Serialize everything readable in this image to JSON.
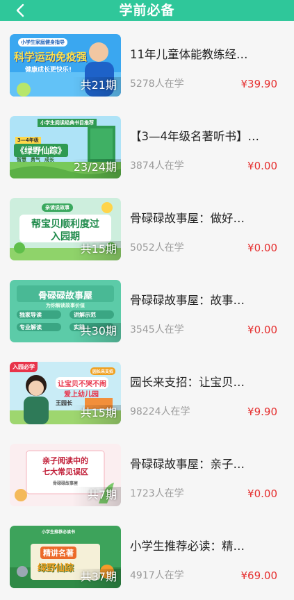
{
  "header": {
    "title": "学前必备",
    "back_icon": "chevron-left-icon"
  },
  "theme": {
    "accent": "#2fc79a",
    "price_color": "#e52f2f",
    "muted": "#9a9a9a"
  },
  "courses": [
    {
      "title": "11年儿童体能教练经…",
      "learners": "5278人在学",
      "price": "¥39.90",
      "periods": "共21期",
      "poster": {
        "banner": "小学生家庭健身指导",
        "headline": "科学运动免疫强",
        "sub": "健康成长更快乐!"
      }
    },
    {
      "title": "【3—4年级名著听书】…",
      "learners": "3874人在学",
      "price": "¥0.00",
      "periods": "23/24期",
      "poster": {
        "banner": "小学生阅读经典书目推荐",
        "grade": "3—4年级",
        "headline": "《绿野仙踪》",
        "tags": [
          "智慧",
          "勇气",
          "成长"
        ]
      }
    },
    {
      "title": "骨碌碌故事屋：做好…",
      "learners": "5052人在学",
      "price": "¥0.00",
      "periods": "共15期",
      "poster": {
        "banner": "亲读说故事",
        "headline": "帮宝贝顺利度过",
        "headline2": "入园期"
      }
    },
    {
      "title": "骨碌碌故事屋：故事…",
      "learners": "3545人在学",
      "price": "¥0.00",
      "periods": "共30期",
      "poster": {
        "headline": "骨碌碌故事屋",
        "sub": "为你解读故事价值",
        "tags": [
          "独家导读",
          "讲解示范",
          "专业解读",
          "实践"
        ]
      }
    },
    {
      "title": "园长来支招：让宝贝…",
      "learners": "98224人在学",
      "price": "¥9.90",
      "periods": "共15期",
      "poster": {
        "badge": "入园必学",
        "corner": "园长来支招",
        "headline": "让宝贝不哭不闹",
        "headline2": "爱上幼儿园",
        "person": "王园长"
      }
    },
    {
      "title": "骨碌碌故事屋：亲子…",
      "learners": "1723人在学",
      "price": "¥0.00",
      "periods": "共7期",
      "poster": {
        "headline": "亲子阅读中的",
        "headline2": "七大常见误区",
        "sub": "骨碌碌故事屋"
      }
    },
    {
      "title": "小学生推荐必读：精…",
      "learners": "4917人在学",
      "price": "¥69.00",
      "periods": "共37期",
      "poster": {
        "banner": "小学生推荐必读书",
        "headline": "精讲名著",
        "headline2": "绿野仙踪"
      }
    }
  ]
}
